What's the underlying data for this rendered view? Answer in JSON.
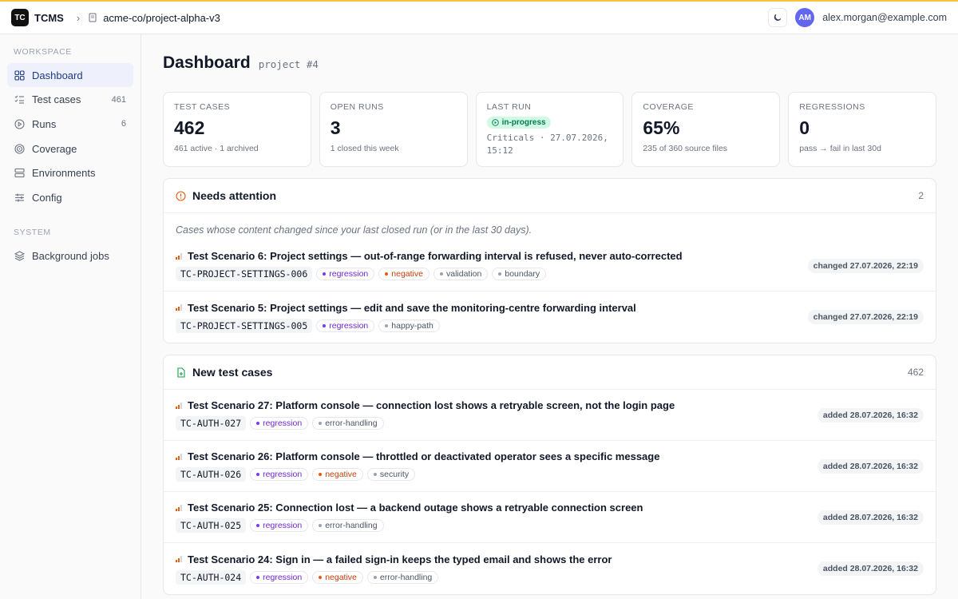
{
  "app": {
    "logo_badge": "TC",
    "name": "TCMS",
    "breadcrumb": "acme-co/project-alpha-v3",
    "user_initials": "AM",
    "user_email": "alex.morgan@example.com"
  },
  "sidebar": {
    "sections": [
      {
        "title": "WORKSPACE",
        "items": [
          {
            "label": "Dashboard",
            "icon": "grid-icon",
            "count": "",
            "active": true
          },
          {
            "label": "Test cases",
            "icon": "checklist-icon",
            "count": "461",
            "active": false
          },
          {
            "label": "Runs",
            "icon": "play-circle-icon",
            "count": "6",
            "active": false
          },
          {
            "label": "Coverage",
            "icon": "target-icon",
            "count": "",
            "active": false
          },
          {
            "label": "Environments",
            "icon": "server-icon",
            "count": "",
            "active": false
          },
          {
            "label": "Config",
            "icon": "sliders-icon",
            "count": "",
            "active": false
          }
        ]
      },
      {
        "title": "SYSTEM",
        "items": [
          {
            "label": "Background jobs",
            "icon": "layers-icon",
            "count": "",
            "active": false
          }
        ]
      }
    ]
  },
  "page": {
    "title": "Dashboard",
    "subtitle": "project #4"
  },
  "stats": {
    "test_cases": {
      "label": "TEST CASES",
      "value": "462",
      "foot": "461 active · 1 archived"
    },
    "open_runs": {
      "label": "OPEN RUNS",
      "value": "3",
      "foot": "1 closed this week"
    },
    "last_run": {
      "label": "LAST RUN",
      "status": "in-progress",
      "detail": "Criticals · 27.07.2026, 15:12"
    },
    "coverage": {
      "label": "COVERAGE",
      "value": "65%",
      "foot": "235 of 360 source files"
    },
    "regressions": {
      "label": "REGRESSIONS",
      "value": "0",
      "foot": "pass → fail in last 30d"
    }
  },
  "attention": {
    "title": "Needs attention",
    "count": "2",
    "note": "Cases whose content changed since your last closed run (or in the last 30 days).",
    "cases": [
      {
        "title": "Test Scenario 6: Project settings — out-of-range forwarding interval is refused, never auto-corrected",
        "id": "TC-PROJECT-SETTINGS-006",
        "tags": [
          {
            "label": "regression",
            "color": "purple"
          },
          {
            "label": "negative",
            "color": "orange"
          },
          {
            "label": "validation",
            "color": "gray"
          },
          {
            "label": "boundary",
            "color": "gray"
          }
        ],
        "date": "changed 27.07.2026, 22:19"
      },
      {
        "title": "Test Scenario 5: Project settings — edit and save the monitoring-centre forwarding interval",
        "id": "TC-PROJECT-SETTINGS-005",
        "tags": [
          {
            "label": "regression",
            "color": "purple"
          },
          {
            "label": "happy-path",
            "color": "gray"
          }
        ],
        "date": "changed 27.07.2026, 22:19"
      }
    ]
  },
  "new_cases": {
    "title": "New test cases",
    "count": "462",
    "cases": [
      {
        "title": "Test Scenario 27: Platform console — connection lost shows a retryable screen, not the login page",
        "id": "TC-AUTH-027",
        "tags": [
          {
            "label": "regression",
            "color": "purple"
          },
          {
            "label": "error-handling",
            "color": "gray"
          }
        ],
        "date": "added 28.07.2026, 16:32"
      },
      {
        "title": "Test Scenario 26: Platform console — throttled or deactivated operator sees a specific message",
        "id": "TC-AUTH-026",
        "tags": [
          {
            "label": "regression",
            "color": "purple"
          },
          {
            "label": "negative",
            "color": "orange"
          },
          {
            "label": "security",
            "color": "gray"
          }
        ],
        "date": "added 28.07.2026, 16:32"
      },
      {
        "title": "Test Scenario 25: Connection lost — a backend outage shows a retryable connection screen",
        "id": "TC-AUTH-025",
        "tags": [
          {
            "label": "regression",
            "color": "purple"
          },
          {
            "label": "error-handling",
            "color": "gray"
          }
        ],
        "date": "added 28.07.2026, 16:32"
      },
      {
        "title": "Test Scenario 24: Sign in — a failed sign-in keeps the typed email and shows the error",
        "id": "TC-AUTH-024",
        "tags": [
          {
            "label": "regression",
            "color": "purple"
          },
          {
            "label": "negative",
            "color": "orange"
          },
          {
            "label": "error-handling",
            "color": "gray"
          }
        ],
        "date": "added 28.07.2026, 16:32"
      }
    ]
  },
  "colors": {
    "accent_bar": "#f5c33b",
    "active_nav_bg": "#eef0fb",
    "tag_purple": "#7c3aed",
    "tag_orange": "#ea580c",
    "status_green": "#047857"
  }
}
